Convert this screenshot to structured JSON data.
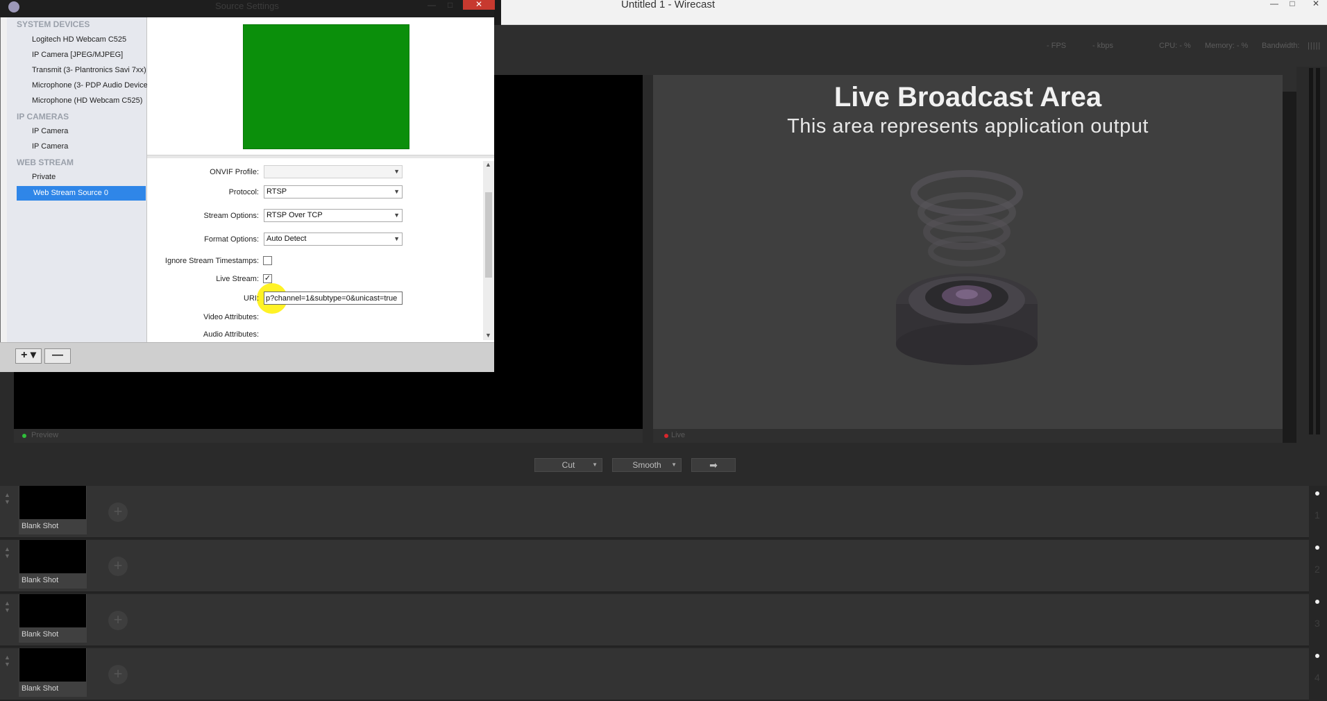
{
  "main_window": {
    "title": "Untitled 1 - Wirecast",
    "controls": {
      "minimize": "—",
      "restore": "□",
      "close": "✕"
    }
  },
  "status": {
    "fps": "- FPS",
    "kbps": "- kbps",
    "cpu": "CPU: - %",
    "memory": "Memory: - %",
    "bandwidth": "Bandwidth:"
  },
  "preview": {
    "label": "Preview"
  },
  "live": {
    "label": "Live",
    "title": "Live Broadcast Area",
    "subtitle": "This area represents application output"
  },
  "transitions": {
    "cut": "Cut",
    "smooth": "Smooth",
    "go": "➡"
  },
  "layers": [
    {
      "shot": "Blank Shot",
      "number": "1"
    },
    {
      "shot": "Blank Shot",
      "number": "2"
    },
    {
      "shot": "Blank Shot",
      "number": "3"
    },
    {
      "shot": "Blank Shot",
      "number": "4"
    }
  ],
  "dialog": {
    "title": "Source Settings",
    "close": "✕",
    "minimize": "—",
    "maximize": "□",
    "groups": {
      "system_devices": "SYSTEM DEVICES",
      "ip_cameras": "IP CAMERAS",
      "web_stream": "WEB STREAM"
    },
    "system_devices": [
      "Logitech HD Webcam C525",
      "IP Camera [JPEG/MJPEG]",
      "Transmit (3- Plantronics Savi 7xx)",
      "Microphone (3- PDP Audio Device",
      "Microphone (HD Webcam C525)"
    ],
    "ip_cameras": [
      "IP Camera",
      "IP Camera"
    ],
    "web_stream": [
      "Private",
      "Web Stream Source 0"
    ],
    "selected_source": "Web Stream Source 0",
    "fields": {
      "onvif_label": "ONVIF Profile:",
      "onvif_value": "",
      "protocol_label": "Protocol:",
      "protocol_value": "RTSP",
      "stream_options_label": "Stream Options:",
      "stream_options_value": "RTSP Over TCP",
      "format_options_label": "Format Options:",
      "format_options_value": "Auto Detect",
      "ignore_timestamps_label": "Ignore Stream Timestamps:",
      "ignore_timestamps_checked": false,
      "live_stream_label": "Live Stream:",
      "live_stream_checked": true,
      "uri_label": "URI:",
      "uri_value": "p?channel=1&subtype=0&unicast=true",
      "video_attributes_label": "Video Attributes:",
      "audio_attributes_label": "Audio Attributes:"
    },
    "footer": {
      "add": "+ ▾",
      "remove": "—"
    }
  }
}
